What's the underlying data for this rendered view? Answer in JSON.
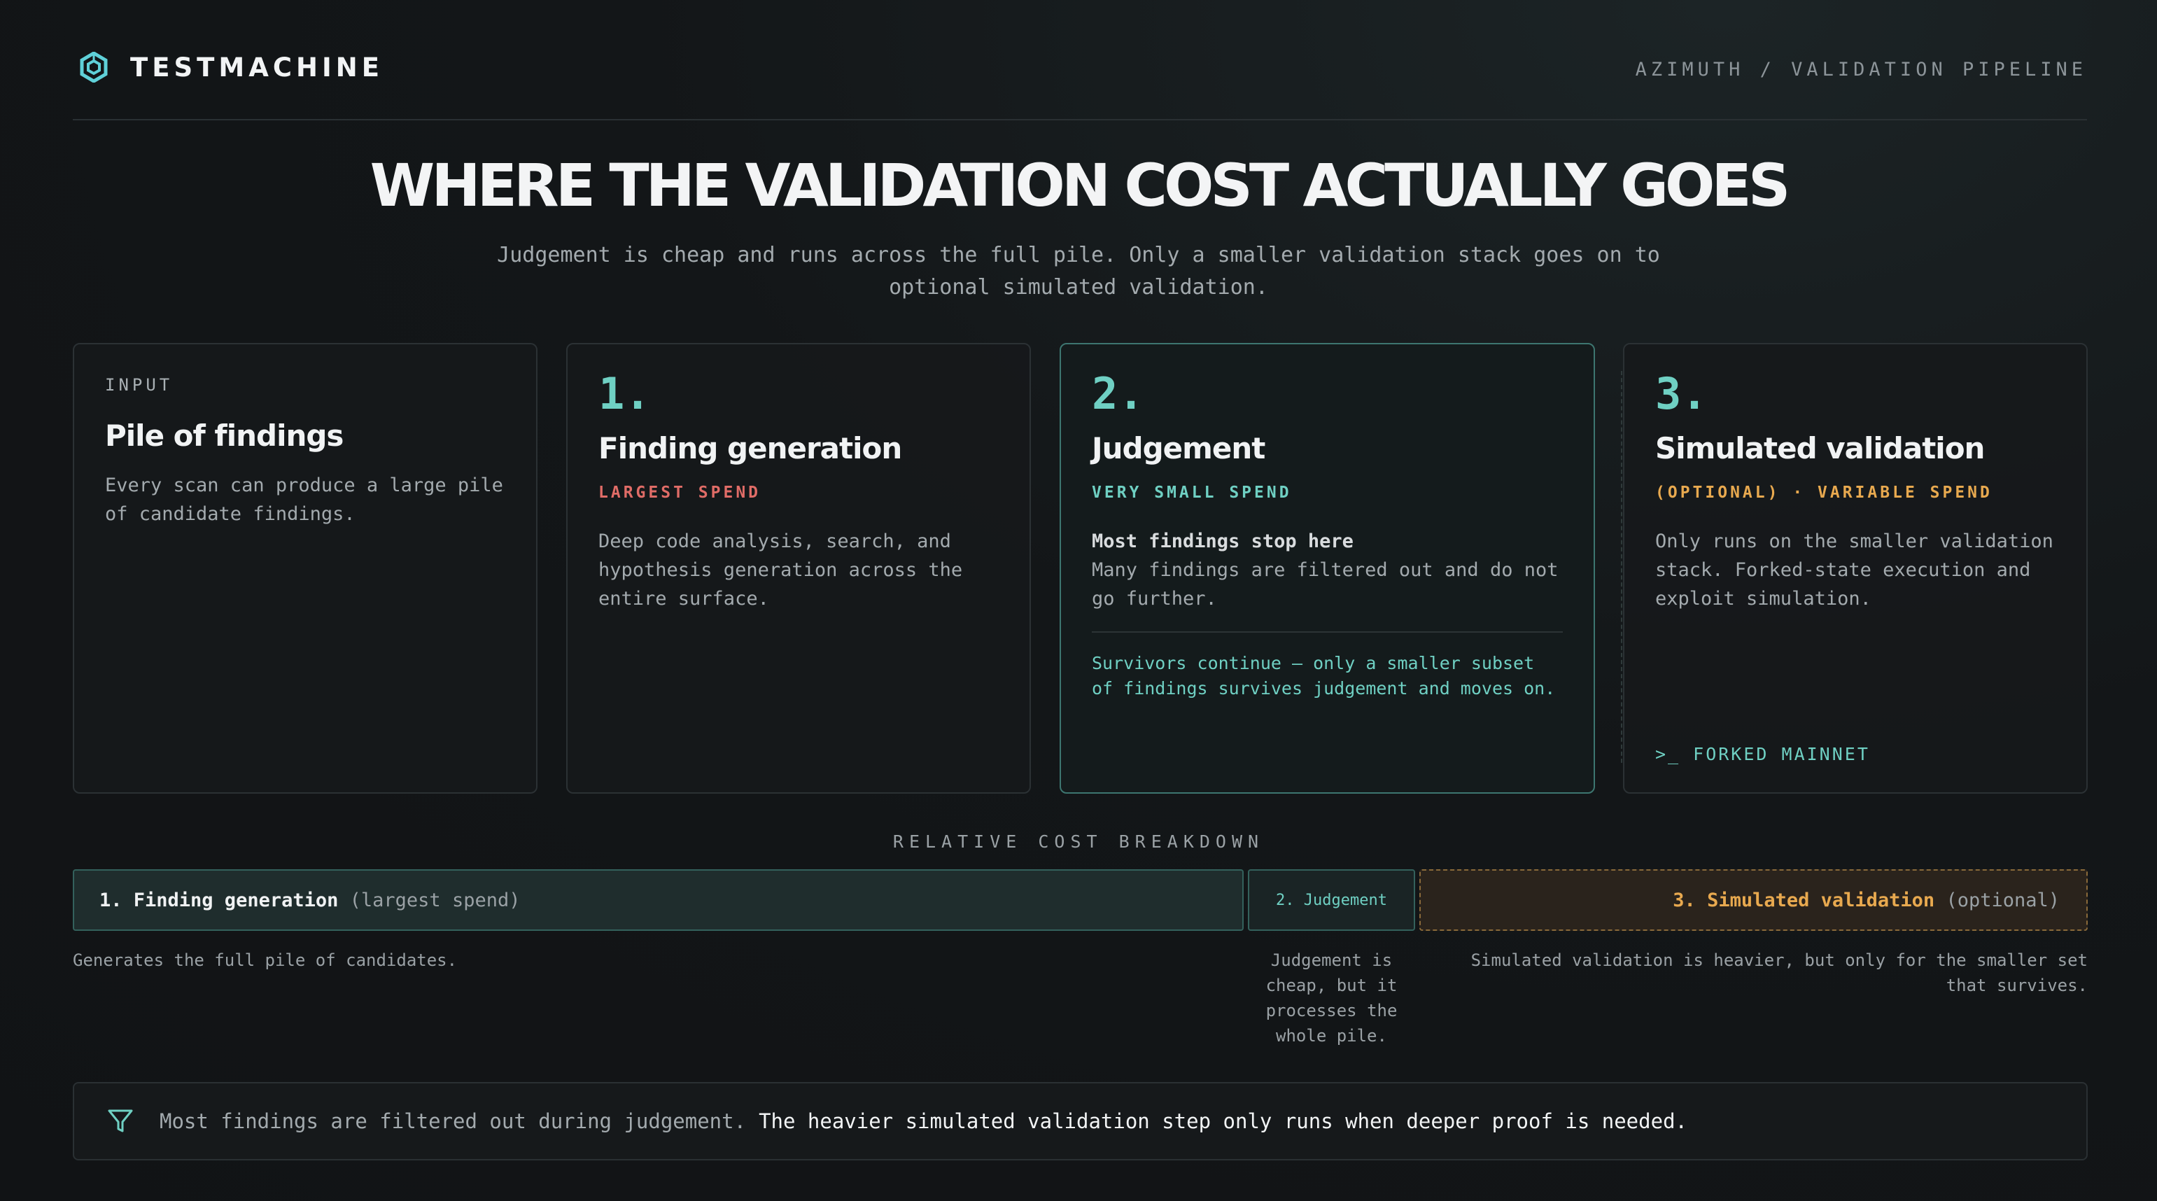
{
  "header": {
    "brand_icon": "hexagon-logo-icon",
    "brand_name": "TESTMACHINE",
    "breadcrumb": "AZIMUTH / VALIDATION PIPELINE"
  },
  "title": "WHERE THE VALIDATION COST ACTUALLY GOES",
  "subtitle": "Judgement is cheap and runs across the full pile. Only a smaller validation stack goes on to optional simulated validation.",
  "cards": {
    "input": {
      "eyebrow": "INPUT",
      "title": "Pile of findings",
      "body": "Every scan can produce a large pile of candidate findings."
    },
    "step1": {
      "number": "1.",
      "title": "Finding generation",
      "spend": "LARGEST SPEND",
      "body": "Deep code analysis, search, and hypothesis generation across the entire surface."
    },
    "step2": {
      "number": "2.",
      "title": "Judgement",
      "spend": "VERY SMALL SPEND",
      "body_strong": "Most findings stop here",
      "body": "Many findings are filtered out and do not go further.",
      "survivors": "Survivors continue — only a smaller subset of findings survives judgement and moves on."
    },
    "step3": {
      "number": "3.",
      "title": "Simulated validation",
      "spend": "(OPTIONAL) · VARIABLE SPEND",
      "body": "Only runs on the smaller validation stack. Forked-state execution and exploit simulation.",
      "tag": ">_ FORKED MAINNET"
    }
  },
  "cost": {
    "label": "RELATIVE COST BREAKDOWN",
    "bars": {
      "gen_label": "1. Finding generation",
      "gen_suffix": "(largest spend)",
      "judge_label": "2. Judgement",
      "sim_label": "3. Simulated validation",
      "sim_suffix": "(optional)"
    },
    "notes": {
      "gen": "Generates the full pile of candidates.",
      "judge": "Judgement is cheap, but it processes the whole pile.",
      "sim": "Simulated validation is heavier, but only for the smaller set that survives."
    }
  },
  "callout": {
    "icon": "filter-icon",
    "muted": "Most findings are filtered out during judgement.",
    "strong": "The heavier simulated validation step only runs when deeper proof is needed."
  },
  "colors": {
    "accent_teal": "#6fd0c3",
    "spend_red": "#e06c67",
    "spend_orange": "#e8a94f",
    "background": "#121517"
  }
}
